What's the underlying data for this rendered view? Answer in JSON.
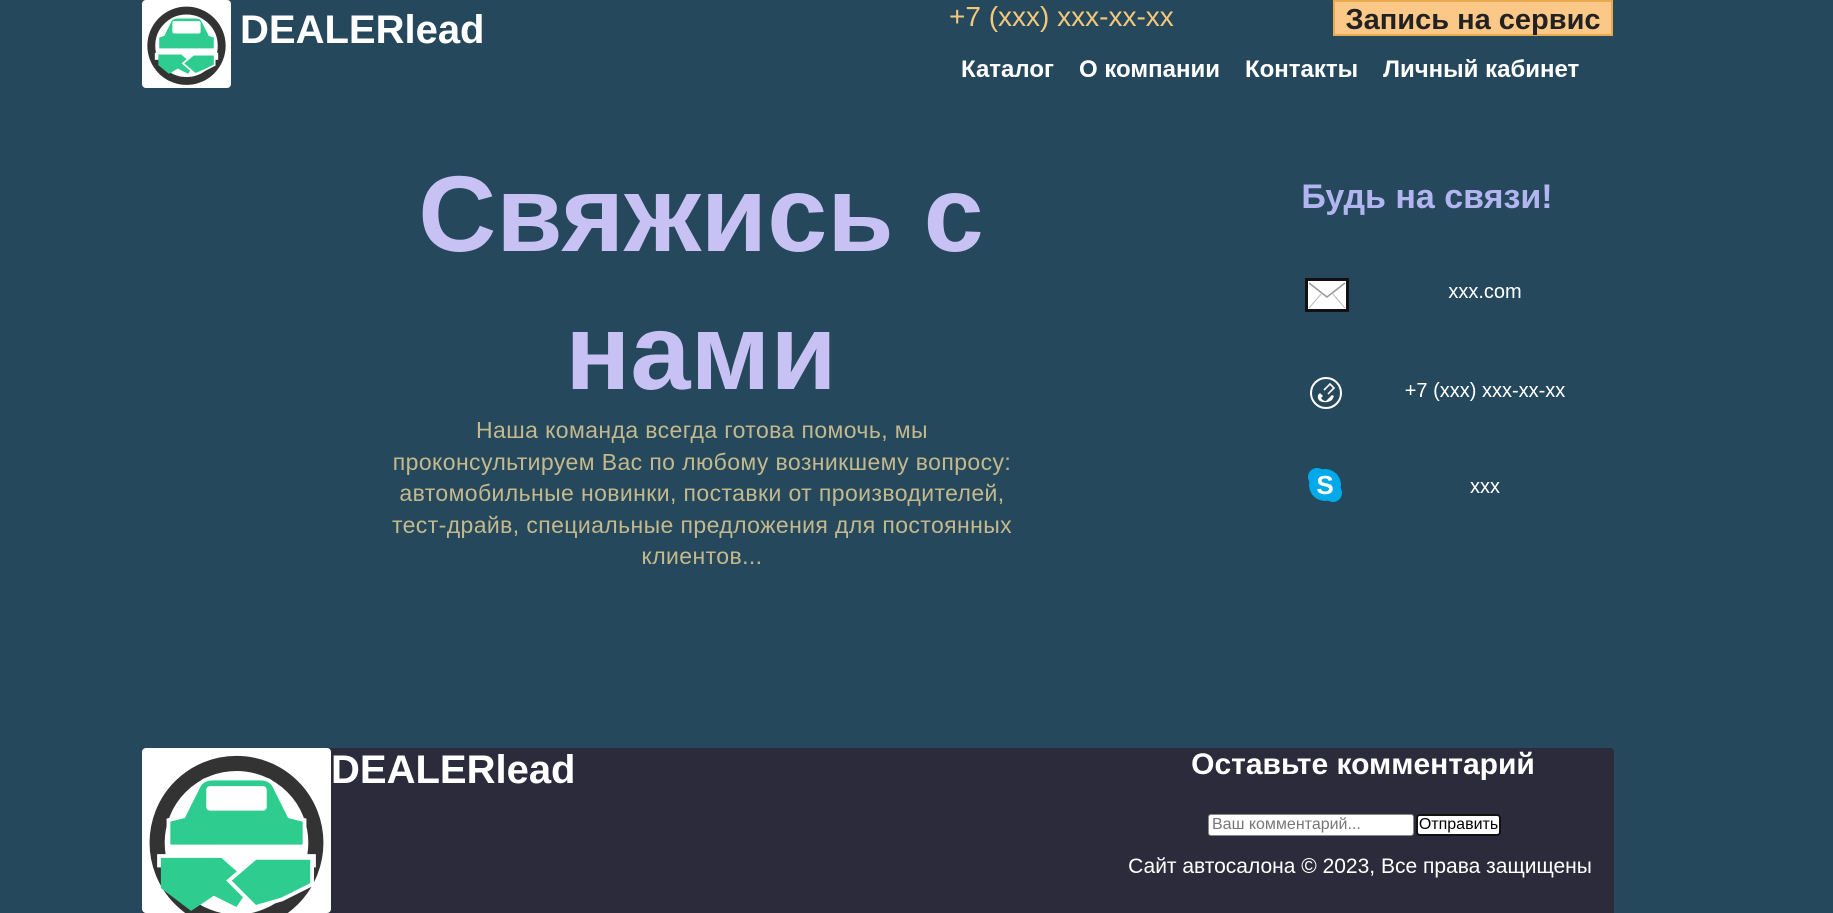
{
  "header": {
    "brand": "DEALERlead",
    "phone": "+7 (xxx) xxx-xx-xx",
    "cta_label": "Запись на сервис",
    "nav": [
      "Каталог",
      "О компании",
      "Контакты",
      "Личный кабинет"
    ]
  },
  "hero": {
    "title_line1": "Свяжись с",
    "title_line2": "нами",
    "text": "Наша команда всегда готова помочь, мы проконсультируем Вас по любому возникшему вопросу: автомобильные новинки, поставки от производителей, тест-драйв, специальные предложения для постоянных клиентов..."
  },
  "contacts": {
    "title": "Будь на связи!",
    "items": [
      {
        "icon": "mail-icon",
        "value": "xxx.com"
      },
      {
        "icon": "phone-icon",
        "value": "+7 (xxx) xxx-xx-xx"
      },
      {
        "icon": "skype-icon",
        "value": "xxx"
      }
    ]
  },
  "footer": {
    "brand": "DEALERlead",
    "comment_heading": "Оставьте комментарий",
    "comment_placeholder": "Ваш комментарий...",
    "send_label": "Отправить",
    "copyright": "Сайт автосалона © 2023, Все права защищены"
  },
  "colors": {
    "background": "#25485c",
    "footer_bg": "#2c2b3b",
    "accent_yellow": "#fbc887",
    "hero_title": "#c7c2f3",
    "logo_green": "#2ecc8f"
  }
}
